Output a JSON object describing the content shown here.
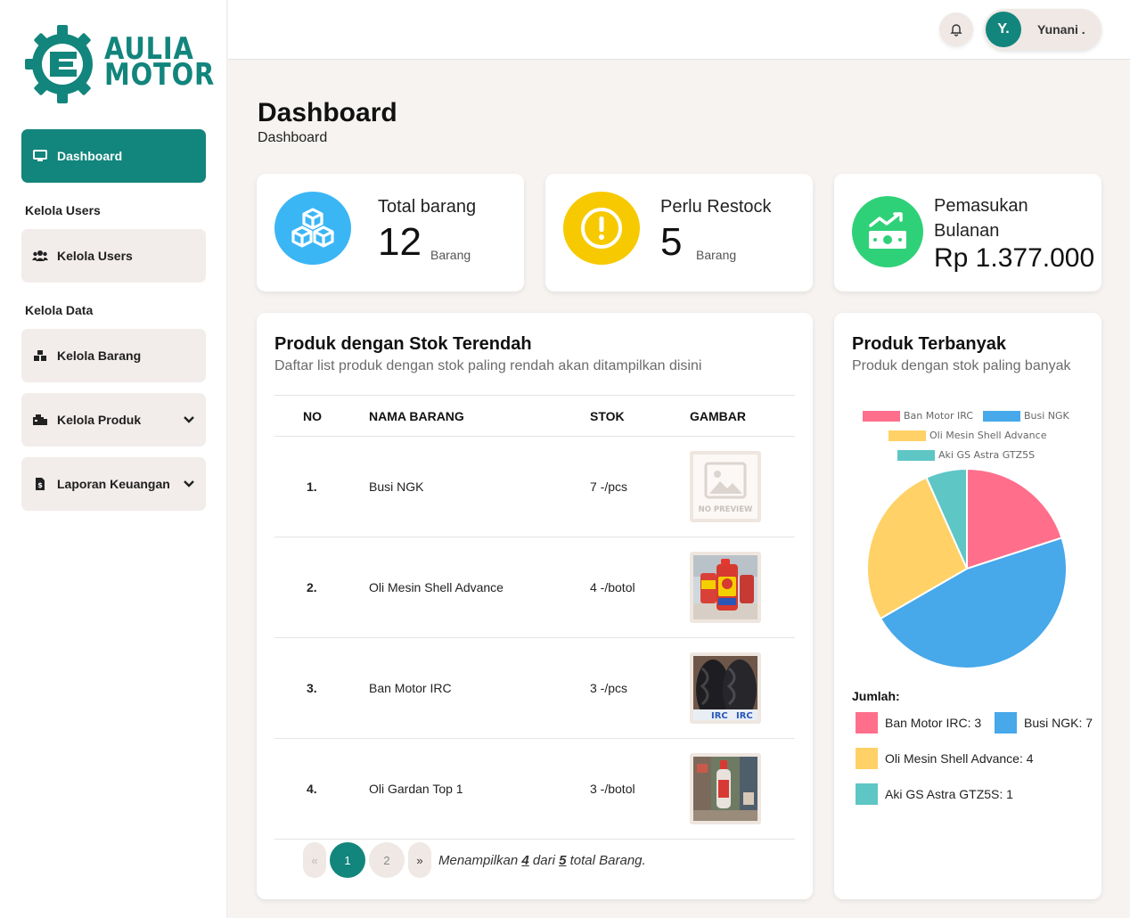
{
  "brand": {
    "line1": "AULIA",
    "line2": "MOTOR",
    "color": "#12857c"
  },
  "sidebar": {
    "dashboard": "Dashboard",
    "section_users": "Kelola Users",
    "users": "Kelola Users",
    "section_data": "Kelola Data",
    "barang": "Kelola Barang",
    "produk": "Kelola Produk",
    "laporan": "Laporan Keuangan"
  },
  "header": {
    "avatar": "Y.",
    "user_name": "Yunani ."
  },
  "page": {
    "title": "Dashboard",
    "breadcrumb": "Dashboard"
  },
  "stats": [
    {
      "label": "Total barang",
      "value": "12",
      "unit": "Barang",
      "icon": "boxes-icon",
      "color": "#3bb6f5"
    },
    {
      "label": "Perlu Restock",
      "value": "5",
      "unit": "Barang",
      "icon": "exclamation-icon",
      "color": "#f7c900"
    },
    {
      "label_line1": "Pemasukan",
      "label_line2": "Bulanan",
      "value": "Rp 1.377.000",
      "icon": "money-trend-icon",
      "color": "#2fd178"
    }
  ],
  "low_stock": {
    "title": "Produk dengan Stok Terendah",
    "subtitle": "Daftar list produk dengan stok paling rendah akan ditampilkan disini",
    "columns": [
      "NO",
      "NAMA BARANG",
      "STOK",
      "GAMBAR"
    ],
    "rows": [
      {
        "no": "1.",
        "name": "Busi NGK",
        "stock": "7 -/pcs",
        "image": "no-preview",
        "image_text": "NO PREVIEW"
      },
      {
        "no": "2.",
        "name": "Oli Mesin Shell Advance",
        "stock": "4 -/botol",
        "image": "oil-bottle"
      },
      {
        "no": "3.",
        "name": "Ban Motor IRC",
        "stock": "3 -/pcs",
        "image": "tires"
      },
      {
        "no": "4.",
        "name": "Oli Gardan Top 1",
        "stock": "3 -/botol",
        "image": "gear-oil"
      }
    ],
    "pagination": {
      "prev": "«",
      "pages": [
        "1",
        "2"
      ],
      "current": "1",
      "next": "»",
      "info_prefix": "Menampilkan",
      "shown": "4",
      "info_mid": "dari",
      "total": "5",
      "info_suffix": "total Barang."
    }
  },
  "top_products": {
    "title": "Produk Terbanyak",
    "subtitle": "Produk dengan stok paling banyak",
    "jumlah_label": "Jumlah:",
    "jumlah_items": [
      "Ban Motor IRC: 3",
      "Busi NGK: 7",
      "Oli Mesin Shell Advance: 4",
      "Aki GS Astra GTZ5S: 1"
    ]
  },
  "chart_data": {
    "type": "pie",
    "categories": [
      "Ban Motor IRC",
      "Busi NGK",
      "Oli Mesin Shell Advance",
      "Aki GS Astra GTZ5S"
    ],
    "values": [
      3,
      7,
      4,
      1
    ],
    "colors": [
      "#ff6f8c",
      "#47a8ea",
      "#ffd166",
      "#5ec6c5"
    ],
    "legend": "top"
  }
}
